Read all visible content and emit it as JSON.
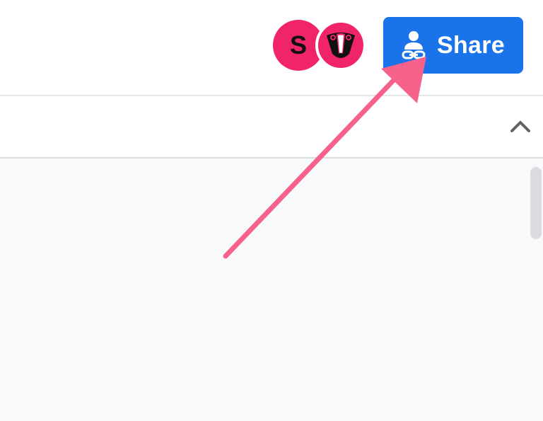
{
  "header": {
    "avatars": [
      {
        "initial": "S",
        "color": "#f0246b"
      },
      {
        "icon": "badger-icon",
        "color": "#f0246b"
      }
    ],
    "share_button": {
      "label": "Share",
      "icon": "person-link-icon",
      "color": "#1a73e8"
    }
  },
  "section": {
    "collapse_icon": "chevron-up-icon"
  },
  "annotation": {
    "arrow_color": "#f7628c"
  }
}
